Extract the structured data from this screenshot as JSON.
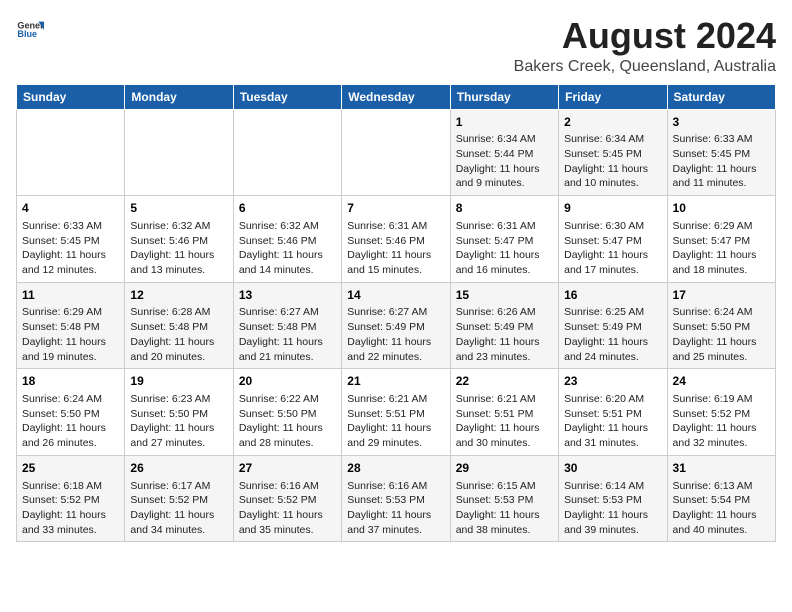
{
  "logo": {
    "general": "General",
    "blue": "Blue"
  },
  "title": "August 2024",
  "subtitle": "Bakers Creek, Queensland, Australia",
  "days_of_week": [
    "Sunday",
    "Monday",
    "Tuesday",
    "Wednesday",
    "Thursday",
    "Friday",
    "Saturday"
  ],
  "weeks": [
    [
      {
        "day": "",
        "info": ""
      },
      {
        "day": "",
        "info": ""
      },
      {
        "day": "",
        "info": ""
      },
      {
        "day": "",
        "info": ""
      },
      {
        "day": "1",
        "info": "Sunrise: 6:34 AM\nSunset: 5:44 PM\nDaylight: 11 hours\nand 9 minutes."
      },
      {
        "day": "2",
        "info": "Sunrise: 6:34 AM\nSunset: 5:45 PM\nDaylight: 11 hours\nand 10 minutes."
      },
      {
        "day": "3",
        "info": "Sunrise: 6:33 AM\nSunset: 5:45 PM\nDaylight: 11 hours\nand 11 minutes."
      }
    ],
    [
      {
        "day": "4",
        "info": "Sunrise: 6:33 AM\nSunset: 5:45 PM\nDaylight: 11 hours\nand 12 minutes."
      },
      {
        "day": "5",
        "info": "Sunrise: 6:32 AM\nSunset: 5:46 PM\nDaylight: 11 hours\nand 13 minutes."
      },
      {
        "day": "6",
        "info": "Sunrise: 6:32 AM\nSunset: 5:46 PM\nDaylight: 11 hours\nand 14 minutes."
      },
      {
        "day": "7",
        "info": "Sunrise: 6:31 AM\nSunset: 5:46 PM\nDaylight: 11 hours\nand 15 minutes."
      },
      {
        "day": "8",
        "info": "Sunrise: 6:31 AM\nSunset: 5:47 PM\nDaylight: 11 hours\nand 16 minutes."
      },
      {
        "day": "9",
        "info": "Sunrise: 6:30 AM\nSunset: 5:47 PM\nDaylight: 11 hours\nand 17 minutes."
      },
      {
        "day": "10",
        "info": "Sunrise: 6:29 AM\nSunset: 5:47 PM\nDaylight: 11 hours\nand 18 minutes."
      }
    ],
    [
      {
        "day": "11",
        "info": "Sunrise: 6:29 AM\nSunset: 5:48 PM\nDaylight: 11 hours\nand 19 minutes."
      },
      {
        "day": "12",
        "info": "Sunrise: 6:28 AM\nSunset: 5:48 PM\nDaylight: 11 hours\nand 20 minutes."
      },
      {
        "day": "13",
        "info": "Sunrise: 6:27 AM\nSunset: 5:48 PM\nDaylight: 11 hours\nand 21 minutes."
      },
      {
        "day": "14",
        "info": "Sunrise: 6:27 AM\nSunset: 5:49 PM\nDaylight: 11 hours\nand 22 minutes."
      },
      {
        "day": "15",
        "info": "Sunrise: 6:26 AM\nSunset: 5:49 PM\nDaylight: 11 hours\nand 23 minutes."
      },
      {
        "day": "16",
        "info": "Sunrise: 6:25 AM\nSunset: 5:49 PM\nDaylight: 11 hours\nand 24 minutes."
      },
      {
        "day": "17",
        "info": "Sunrise: 6:24 AM\nSunset: 5:50 PM\nDaylight: 11 hours\nand 25 minutes."
      }
    ],
    [
      {
        "day": "18",
        "info": "Sunrise: 6:24 AM\nSunset: 5:50 PM\nDaylight: 11 hours\nand 26 minutes."
      },
      {
        "day": "19",
        "info": "Sunrise: 6:23 AM\nSunset: 5:50 PM\nDaylight: 11 hours\nand 27 minutes."
      },
      {
        "day": "20",
        "info": "Sunrise: 6:22 AM\nSunset: 5:50 PM\nDaylight: 11 hours\nand 28 minutes."
      },
      {
        "day": "21",
        "info": "Sunrise: 6:21 AM\nSunset: 5:51 PM\nDaylight: 11 hours\nand 29 minutes."
      },
      {
        "day": "22",
        "info": "Sunrise: 6:21 AM\nSunset: 5:51 PM\nDaylight: 11 hours\nand 30 minutes."
      },
      {
        "day": "23",
        "info": "Sunrise: 6:20 AM\nSunset: 5:51 PM\nDaylight: 11 hours\nand 31 minutes."
      },
      {
        "day": "24",
        "info": "Sunrise: 6:19 AM\nSunset: 5:52 PM\nDaylight: 11 hours\nand 32 minutes."
      }
    ],
    [
      {
        "day": "25",
        "info": "Sunrise: 6:18 AM\nSunset: 5:52 PM\nDaylight: 11 hours\nand 33 minutes."
      },
      {
        "day": "26",
        "info": "Sunrise: 6:17 AM\nSunset: 5:52 PM\nDaylight: 11 hours\nand 34 minutes."
      },
      {
        "day": "27",
        "info": "Sunrise: 6:16 AM\nSunset: 5:52 PM\nDaylight: 11 hours\nand 35 minutes."
      },
      {
        "day": "28",
        "info": "Sunrise: 6:16 AM\nSunset: 5:53 PM\nDaylight: 11 hours\nand 37 minutes."
      },
      {
        "day": "29",
        "info": "Sunrise: 6:15 AM\nSunset: 5:53 PM\nDaylight: 11 hours\nand 38 minutes."
      },
      {
        "day": "30",
        "info": "Sunrise: 6:14 AM\nSunset: 5:53 PM\nDaylight: 11 hours\nand 39 minutes."
      },
      {
        "day": "31",
        "info": "Sunrise: 6:13 AM\nSunset: 5:54 PM\nDaylight: 11 hours\nand 40 minutes."
      }
    ]
  ]
}
